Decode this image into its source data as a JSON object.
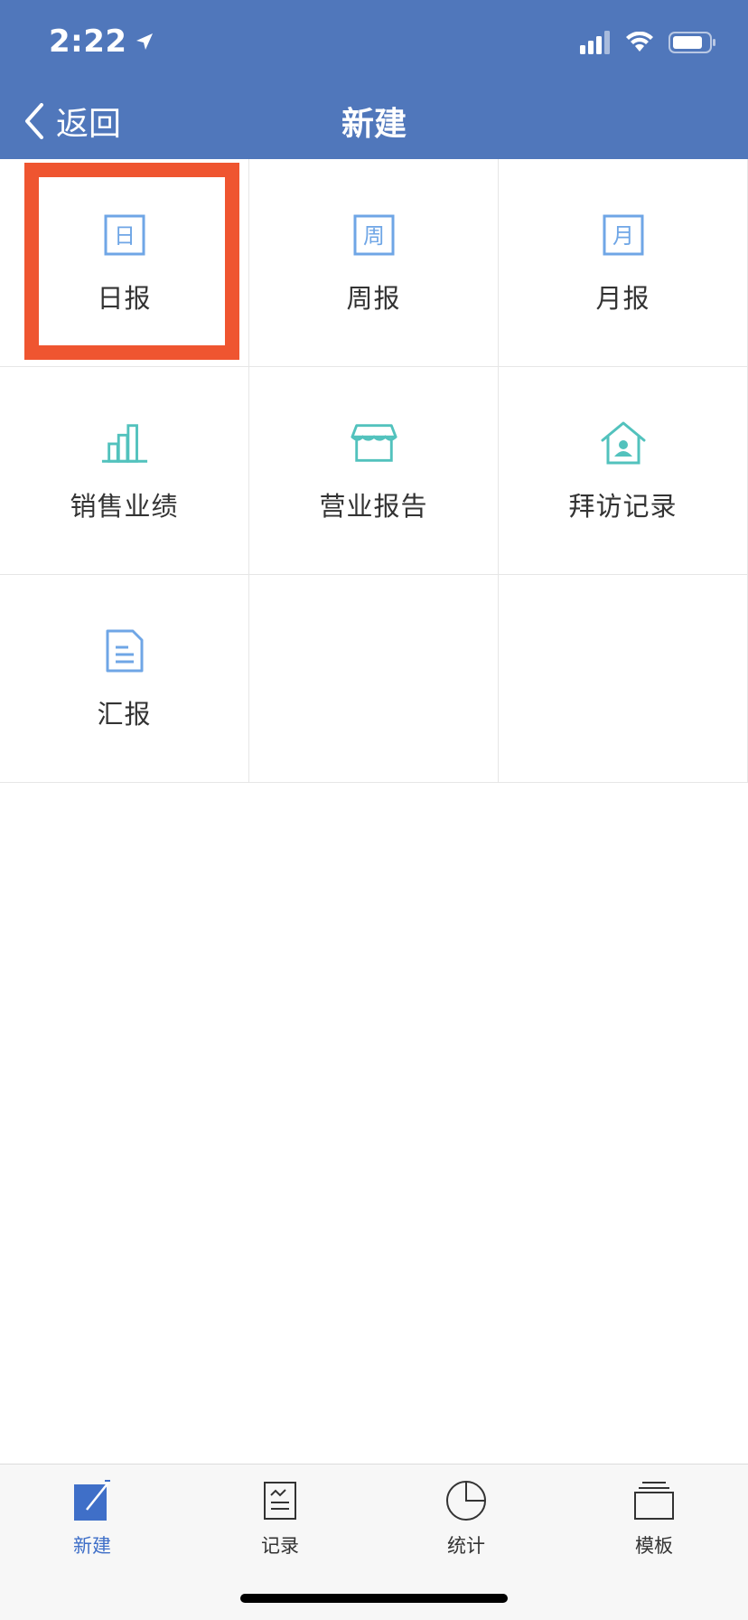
{
  "status_bar": {
    "time": "2:22",
    "location_icon": "location-arrow-icon",
    "signal_icon": "cellular-signal-icon",
    "wifi_icon": "wifi-icon",
    "battery_icon": "battery-icon"
  },
  "nav": {
    "back_label": "返回",
    "title": "新建"
  },
  "colors": {
    "header_bg": "#5077bb",
    "blue_icon": "#6fa6e6",
    "teal_icon": "#52c2bd",
    "highlight_border": "#ef5530",
    "active_tab": "#3f6fc8"
  },
  "grid": {
    "items": [
      {
        "label": "日报",
        "icon": "daily-report-icon",
        "glyph": "日"
      },
      {
        "label": "周报",
        "icon": "weekly-report-icon",
        "glyph": "周"
      },
      {
        "label": "月报",
        "icon": "monthly-report-icon",
        "glyph": "月"
      },
      {
        "label": "销售业绩",
        "icon": "bar-chart-icon"
      },
      {
        "label": "营业报告",
        "icon": "storefront-icon"
      },
      {
        "label": "拜访记录",
        "icon": "house-person-icon"
      },
      {
        "label": "汇报",
        "icon": "document-icon"
      }
    ]
  },
  "tabbar": {
    "items": [
      {
        "label": "新建",
        "icon": "new-edit-icon",
        "active": true
      },
      {
        "label": "记录",
        "icon": "record-list-icon",
        "active": false
      },
      {
        "label": "统计",
        "icon": "pie-chart-icon",
        "active": false
      },
      {
        "label": "模板",
        "icon": "template-stack-icon",
        "active": false
      }
    ]
  }
}
